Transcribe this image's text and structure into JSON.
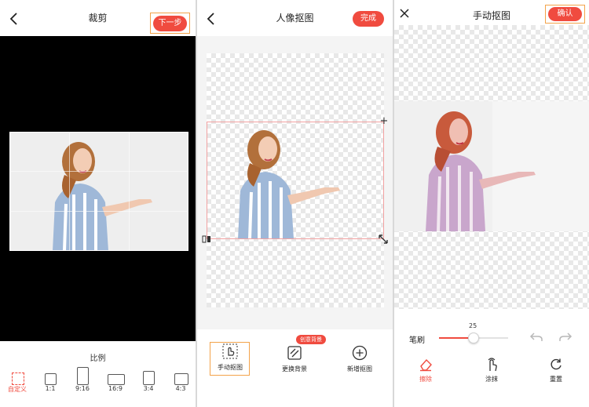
{
  "panel1": {
    "title": "裁剪",
    "next_label": "下一步",
    "ratio_title": "比例",
    "ratios": [
      "自定义",
      "1:1",
      "9:16",
      "16:9",
      "3:4",
      "4:3"
    ]
  },
  "panel2": {
    "title": "人像抠图",
    "done_label": "完成",
    "tools": [
      {
        "label": "手动抠图",
        "icon": "hand-pointer-icon"
      },
      {
        "label": "更换背景",
        "icon": "background-pattern-icon",
        "badge": "创意背景"
      },
      {
        "label": "新增抠图",
        "icon": "plus-circle-icon"
      }
    ]
  },
  "panel3": {
    "title": "手动抠图",
    "confirm_label": "确认",
    "brush_label": "笔刷",
    "brush_value": "25",
    "brush_level": 0.5,
    "tools": [
      {
        "label": "擦除",
        "icon": "eraser-icon"
      },
      {
        "label": "涂抹",
        "icon": "hand-smear-icon"
      },
      {
        "label": "重置",
        "icon": "reset-icon"
      }
    ]
  },
  "colors": {
    "accent": "#f04b3f",
    "highlight": "#f3a34a",
    "selection": "#f2a2a2"
  }
}
